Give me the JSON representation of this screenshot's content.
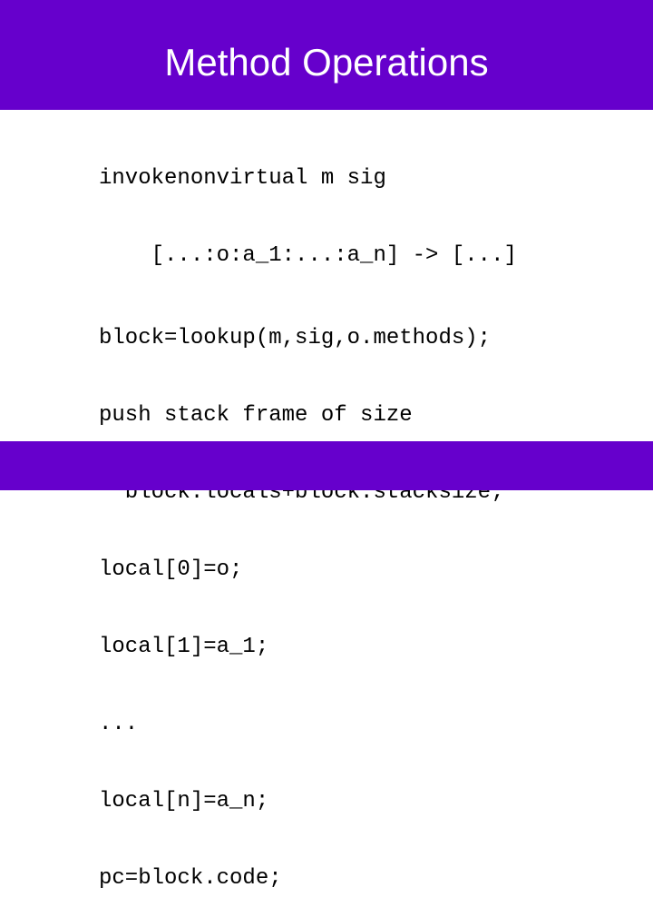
{
  "slide": {
    "title": "Method Operations",
    "colors": {
      "band": "#6600cc",
      "title_text": "#ffffff",
      "body_text": "#000000"
    },
    "signature": [
      "invokenonvirtual m sig",
      "    [...:o:a_1:...:a_n] -> [...]"
    ],
    "body": [
      "block=lookup(m,sig,o.methods);",
      "push stack frame of size",
      "  block.locals+block.stacksize;",
      "local[0]=o;",
      "local[1]=a_1;",
      "...",
      "local[n]=a_n;",
      "pc=block.code;"
    ]
  }
}
